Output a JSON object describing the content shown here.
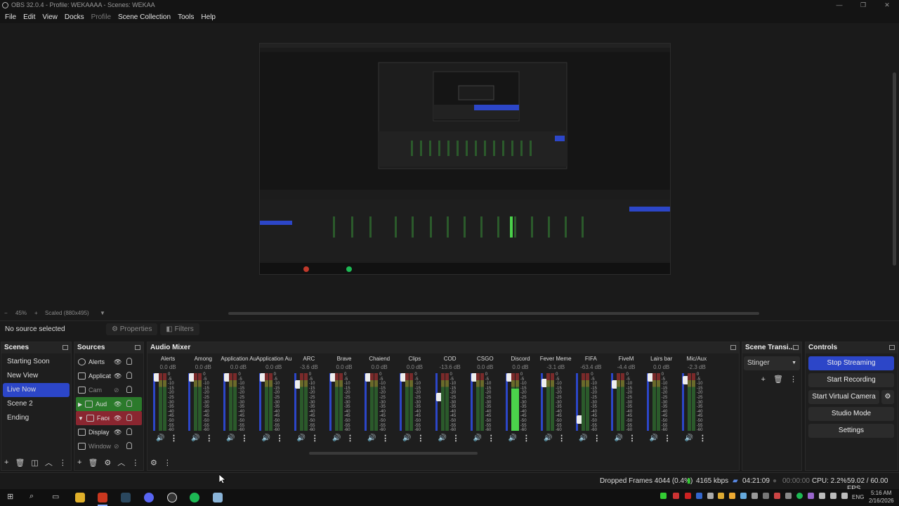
{
  "window": {
    "title": "OBS 32.0.4 - Profile: WEKAAAA - Scenes: WEKAA"
  },
  "menu": [
    "File",
    "Edit",
    "View",
    "Docks",
    "Profile",
    "Scene Collection",
    "Tools",
    "Help"
  ],
  "zoom": {
    "level": "45%",
    "scaled": "Scaled (880x495)"
  },
  "source_toolbar": {
    "status": "No source selected",
    "properties": "Properties",
    "filters": "Filters"
  },
  "scenes": {
    "title": "Scenes",
    "items": [
      "Starting Soon",
      "New View",
      "Live Now",
      "Scene 2",
      "Ending"
    ],
    "active": "Live Now"
  },
  "sources": {
    "title": "Sources",
    "items": [
      {
        "name": "Alerts"
      },
      {
        "name": "Applicat"
      },
      {
        "name": "Cam"
      },
      {
        "name": "Aud"
      },
      {
        "name": "Face"
      },
      {
        "name": "Display"
      },
      {
        "name": "Window"
      }
    ]
  },
  "mixer": {
    "title": "Audio Mixer",
    "channels": [
      {
        "name": "Alerts",
        "db": "0.0 dB"
      },
      {
        "name": "Among",
        "db": "0.0 dB"
      },
      {
        "name": "Application Audio C",
        "db": "0.0 dB"
      },
      {
        "name": "Application Audio C",
        "db": "0.0 dB"
      },
      {
        "name": "ARC",
        "db": "-3.6 dB"
      },
      {
        "name": "Brave",
        "db": "0.0 dB"
      },
      {
        "name": "Chaiend",
        "db": "0.0 dB"
      },
      {
        "name": "Clips",
        "db": "0.0 dB"
      },
      {
        "name": "COD",
        "db": "-13.6 dB"
      },
      {
        "name": "CSGO",
        "db": "0.0 dB"
      },
      {
        "name": "Discord",
        "db": "0.0 dB"
      },
      {
        "name": "Fever Meme",
        "db": "-3.1 dB"
      },
      {
        "name": "FIFA",
        "db": "-63.4 dB"
      },
      {
        "name": "FiveM",
        "db": "-4.4 dB"
      },
      {
        "name": "Lairs bar",
        "db": "0.0 dB"
      },
      {
        "name": "Mic/Aux",
        "db": "-2.3 dB"
      }
    ],
    "scale": [
      "0",
      "-5",
      "-10",
      "-15",
      "-20",
      "-25",
      "-30",
      "-35",
      "-40",
      "-45",
      "-50",
      "-55",
      "-60"
    ]
  },
  "transitions": {
    "title": "Scene Transi...",
    "selected": "Stinger"
  },
  "controls": {
    "title": "Controls",
    "stop_streaming": "Stop Streaming",
    "start_recording": "Start Recording",
    "start_virtual_camera": "Start Virtual Camera",
    "studio_mode": "Studio Mode",
    "settings": "Settings"
  },
  "status": {
    "dropped_frames": "Dropped Frames 4044 (0.4%)",
    "bitrate": "4165 kbps",
    "stream_time": "04:21:09",
    "rec_time": "00:00:00",
    "cpu": "CPU: 2.2%",
    "fps": "59.02 / 60.00 FPS"
  },
  "taskbar": {
    "lang": "ENG",
    "time": "5:16 AM",
    "date": "2/16/2026"
  },
  "colors": {
    "accent": "#2c46c8",
    "bg": "#1a1a1a",
    "green_source": "#2b7a2b",
    "red_source": "#8a2630"
  }
}
